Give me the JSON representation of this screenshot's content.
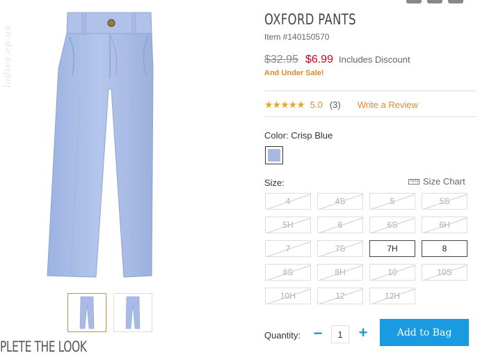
{
  "watermark": "ladies.ep.us",
  "product": {
    "title": "OXFORD PANTS",
    "item_number": "Item #140150570",
    "old_price": "$32.95",
    "new_price": "$6.99",
    "discount_note": "Includes Discount",
    "sale_note": "And Under Sale!"
  },
  "rating": {
    "stars": "★★★★★",
    "value": "5.0",
    "count": "(3)",
    "write_review": "Write a Review"
  },
  "color": {
    "label": "Color: Crisp Blue",
    "swatch_color": "#a8b8e0"
  },
  "size": {
    "label": "Size:",
    "chart_label": "Size Chart",
    "options": [
      {
        "label": "4"
      },
      {
        "label": "4S"
      },
      {
        "label": "5"
      },
      {
        "label": "5S"
      },
      {
        "label": "5H"
      },
      {
        "label": "6"
      },
      {
        "label": "6S"
      },
      {
        "label": "6H"
      },
      {
        "label": "7"
      },
      {
        "label": "7S"
      },
      {
        "label": "7H"
      },
      {
        "label": "8"
      },
      {
        "label": "8S"
      },
      {
        "label": "8H"
      },
      {
        "label": "10"
      },
      {
        "label": "10S"
      },
      {
        "label": "10H"
      },
      {
        "label": "12"
      },
      {
        "label": "12H"
      }
    ]
  },
  "quantity": {
    "label": "Quantity:",
    "minus": "−",
    "value": "1",
    "plus": "+"
  },
  "add_to_bag": "Add to Bag",
  "complete_the_look": "PLETE THE LOOK",
  "colors": {
    "accent": "#e6892b",
    "sale_price": "#d0021b",
    "button": "#1a9ae0"
  }
}
